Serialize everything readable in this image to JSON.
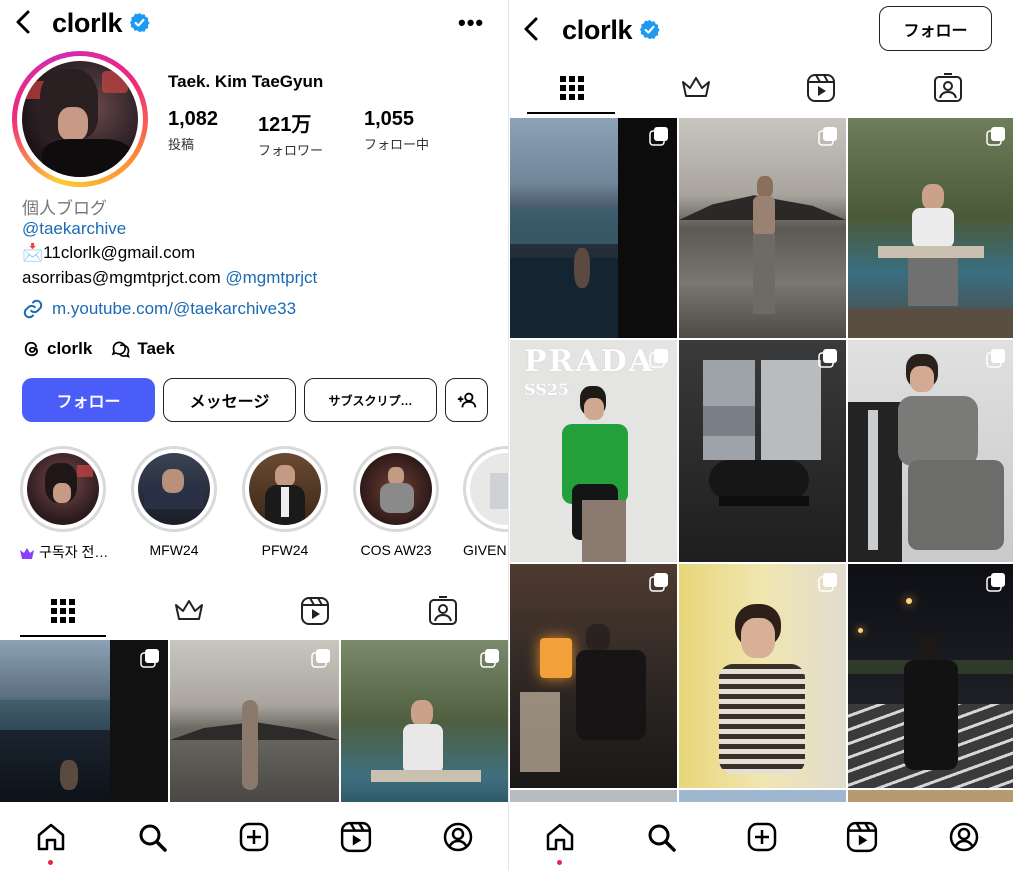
{
  "left": {
    "header": {
      "username": "clorlk",
      "more": "•••"
    },
    "profile": {
      "full_name": "Taek. Kim TaeGyun",
      "stats": [
        {
          "num": "1,082",
          "label": "投稿"
        },
        {
          "num": "121万",
          "label": "フォロワー"
        },
        {
          "num": "1,055",
          "label": "フォロー中"
        }
      ],
      "category": "個人ブログ",
      "bio_handle": "@taekarchive",
      "bio_email1_emoji": "📩",
      "bio_email1": "11clorlk@gmail.com",
      "bio_email2": "asorribas@mgmtprjct.com",
      "bio_email2_handle": "@mgmtprjct",
      "link": "m.youtube.com/@taekarchive33",
      "threads": "clorlk",
      "threads2": "Taek"
    },
    "buttons": {
      "follow": "フォロー",
      "message": "メッセージ",
      "subscribe": "サブスクリプ…"
    },
    "highlights": [
      {
        "label": "구독자 전…"
      },
      {
        "label": "MFW24"
      },
      {
        "label": "PFW24"
      },
      {
        "label": "COS AW23"
      },
      {
        "label": "GIVEN"
      }
    ]
  },
  "right": {
    "header": {
      "username": "clorlk",
      "follow": "フォロー"
    },
    "grid": {
      "prada_text": "PRADA",
      "prada_sub": "SS25"
    }
  },
  "icons": {
    "back": "chevron-left-icon",
    "verified": "verified-badge-icon",
    "grid": "grid-icon",
    "subscriptions": "crown-icon",
    "reels": "reels-icon",
    "tagged": "tagged-icon",
    "home": "home-icon",
    "search": "search-icon",
    "create": "plus-square-icon",
    "profile": "profile-icon"
  },
  "colors": {
    "accent": "#4a5df9",
    "link": "#1b6ab5",
    "verified": "#1d9bf0",
    "notification": "#e0284a"
  }
}
